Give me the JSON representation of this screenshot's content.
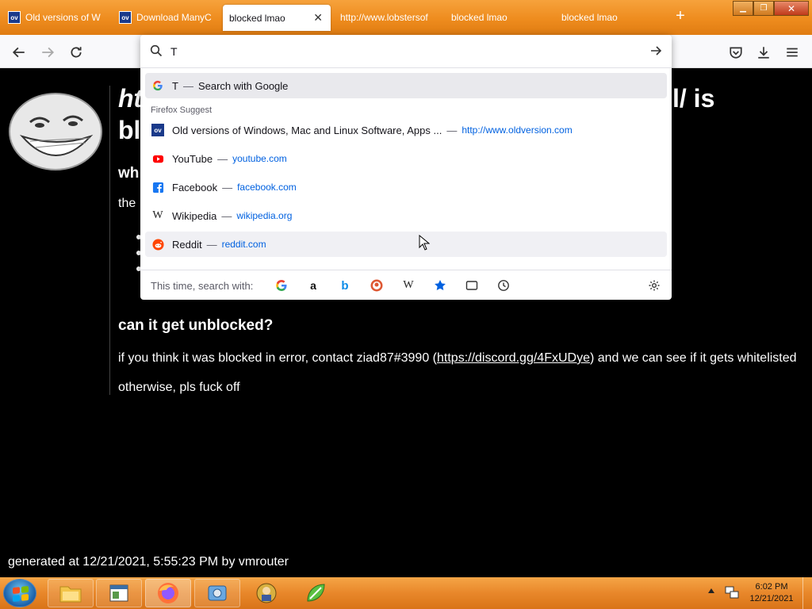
{
  "browser": {
    "tabs": [
      {
        "label": "Old versions of W",
        "favicon": "OV",
        "active": false
      },
      {
        "label": "Download ManyC",
        "favicon": "OV",
        "active": false
      },
      {
        "label": "blocked lmao",
        "favicon": "",
        "active": true
      },
      {
        "label": "http://www.lobstersof",
        "favicon": "",
        "active": false
      },
      {
        "label": "blocked lmao",
        "favicon": "",
        "active": false
      },
      {
        "label": "blocked lmao",
        "favicon": "",
        "active": false
      }
    ],
    "url_input_value": "T"
  },
  "page": {
    "heading_part1": "ht",
    "heading_part2": "bl",
    "heading_tail": "l/ is",
    "subheading1": "wh",
    "text1": "the",
    "subheading2": "can it get unblocked?",
    "paragraph1_before": "if you think it was blocked in error, contact ziad87#3990 (",
    "paragraph1_link": "https://discord.gg/4FxUDye",
    "paragraph1_after": ") and we can see if it gets whitelisted",
    "paragraph2": "otherwise, pls fuck off",
    "footer": "generated at 12/21/2021, 5:55:23 PM by vmrouter"
  },
  "dropdown": {
    "first_result": {
      "query": "T",
      "action": "Search with Google"
    },
    "separator": "—",
    "section_label": "Firefox Suggest",
    "suggestions": [
      {
        "title": "Old versions of Windows, Mac and Linux Software, Apps ...",
        "url": "http://www.oldversion.com",
        "icon": "oldversion-icon"
      },
      {
        "title": "YouTube",
        "url": "youtube.com",
        "icon": "youtube-icon"
      },
      {
        "title": "Facebook",
        "url": "facebook.com",
        "icon": "facebook-icon"
      },
      {
        "title": "Wikipedia",
        "url": "wikipedia.org",
        "icon": "wikipedia-icon"
      },
      {
        "title": "Reddit",
        "url": "reddit.com",
        "icon": "reddit-icon"
      }
    ],
    "search_with_label": "This time, search with:",
    "engines": [
      "google-icon",
      "amazon-icon",
      "bing-icon",
      "duckduckgo-icon",
      "wikipedia-icon",
      "bookmarks-icon",
      "tabs-icon",
      "history-icon"
    ]
  },
  "taskbar": {
    "time": "6:02 PM",
    "date": "12/21/2021"
  },
  "colors": {
    "link": "#0061e0",
    "taskbar": "#e8872a",
    "page_bg": "#000000"
  }
}
